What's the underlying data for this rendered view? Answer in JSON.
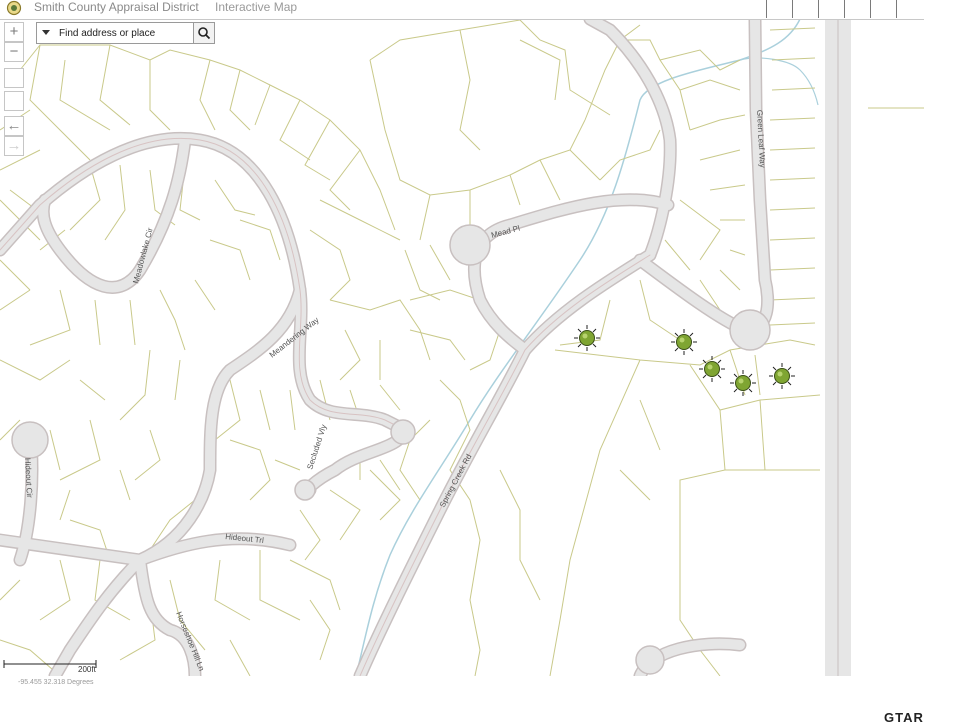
{
  "header": {
    "title": "Smith County Appraisal District",
    "subtitle": "Interactive Map"
  },
  "search": {
    "placeholder": "Find address or place"
  },
  "map_controls": {
    "zoom_in": "+",
    "zoom_out": "−"
  },
  "streets": {
    "mead": "Mead Pl",
    "green_leaf": "Green Leaf Way",
    "meadowlake": "Meadowlake Cir",
    "meandering": "Meandering Way",
    "secluded": "Secluded Vly",
    "spring_creek": "Spring Creek Rd",
    "hideout_cir": "Hideout Cir",
    "hideout_trl": "Hideout Trl",
    "horseshoe": "Horseshoe Hill Ln"
  },
  "scale": {
    "label": "200ft"
  },
  "coordinates": "-95.455 32.318 Degrees",
  "watermark": "GTAR",
  "colors": {
    "parcel_line": "#c9c98a",
    "road_fill": "#e6e6e6",
    "road_edge": "#c8c0c0",
    "creek": "#aad0dc",
    "marker": "#7fa532"
  }
}
